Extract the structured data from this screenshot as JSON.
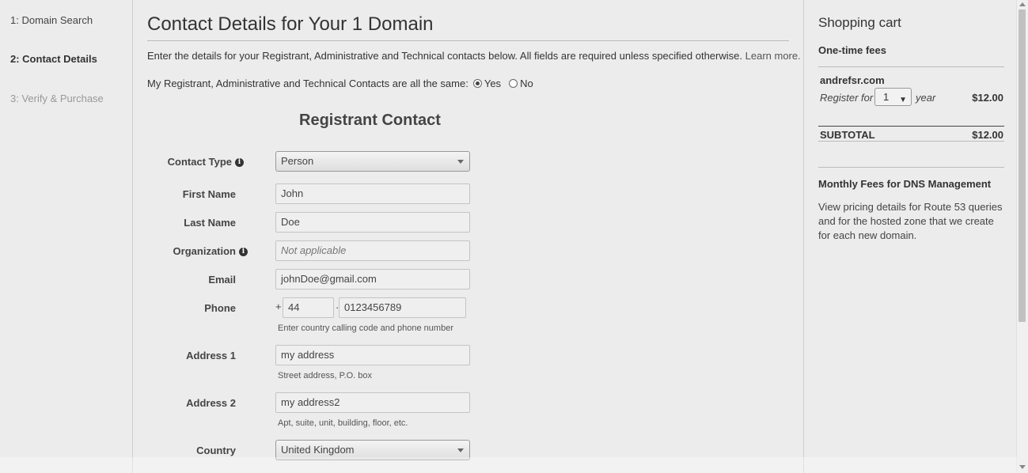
{
  "steps": [
    {
      "label": "1: Domain Search",
      "state": "done"
    },
    {
      "label": "2: Contact Details",
      "state": "active"
    },
    {
      "label": "3: Verify & Purchase",
      "state": "disabled"
    }
  ],
  "main": {
    "title": "Contact Details for Your 1 Domain",
    "intro": "Enter the details for your Registrant, Administrative and Technical contacts below. All fields are required unless specified otherwise.",
    "learn_more": "Learn more.",
    "same_question": "My Registrant, Administrative and Technical Contacts are all the same:",
    "same_yes": "Yes",
    "same_no": "No",
    "same_selected": "Yes",
    "section_title": "Registrant Contact"
  },
  "form": {
    "contact_type": {
      "label": "Contact Type",
      "value": "Person"
    },
    "first_name": {
      "label": "First Name",
      "value": "John"
    },
    "last_name": {
      "label": "Last Name",
      "value": "Doe"
    },
    "organization": {
      "label": "Organization",
      "placeholder": "Not applicable"
    },
    "email": {
      "label": "Email",
      "value": "johnDoe@gmail.com"
    },
    "phone": {
      "label": "Phone",
      "plus": "+",
      "country_code": "44",
      "separator": "·",
      "number": "0123456789",
      "help": "Enter country calling code and phone number"
    },
    "address1": {
      "label": "Address 1",
      "value": "my address",
      "help": "Street address, P.O. box"
    },
    "address2": {
      "label": "Address 2",
      "value": "my address2",
      "help": "Apt, suite, unit, building, floor, etc."
    },
    "country": {
      "label": "Country",
      "value": "United Kingdom"
    }
  },
  "cart": {
    "title": "Shopping cart",
    "one_time_fees": "One-time fees",
    "domain": "andrefsr.com",
    "register_for": "Register for",
    "years": "1",
    "year_unit": "year",
    "price": "$12.00",
    "subtotal_label": "SUBTOTAL",
    "subtotal": "$12.00",
    "dns_title": "Monthly Fees for DNS Management",
    "dns_text": "View pricing details for Route 53 queries and for the hosted zone that we create for each new domain."
  },
  "icons": {
    "info": "info-icon",
    "caret": "caret-down-icon",
    "radio": "radio-icon"
  }
}
